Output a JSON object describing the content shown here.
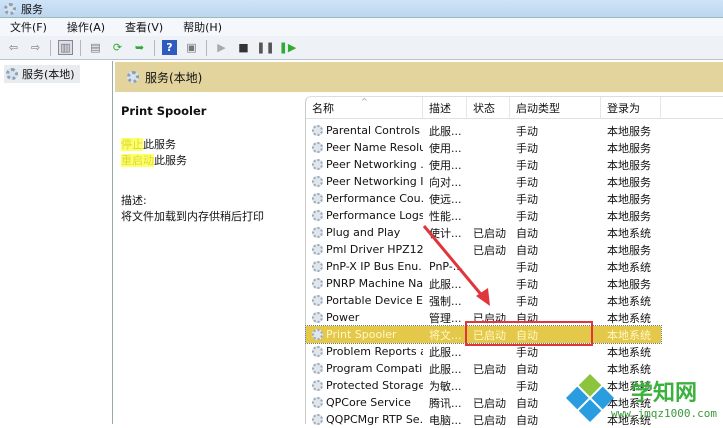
{
  "window": {
    "title": "服务"
  },
  "menu": [
    "文件(F)",
    "操作(A)",
    "查看(V)",
    "帮助(H)"
  ],
  "tree": {
    "root": "服务(本地)"
  },
  "banner": {
    "title": "服务(本地)"
  },
  "details": {
    "service_name": "Print Spooler",
    "stop_link": "停止",
    "stop_suffix": "此服务",
    "restart_link": "重启动",
    "restart_suffix": "此服务",
    "desc_label": "描述:",
    "desc_text": "将文件加载到内存供稍后打印"
  },
  "columns": [
    "名称",
    "描述",
    "状态",
    "启动类型",
    "登录为"
  ],
  "rows": [
    [
      "Parental Controls",
      "此服...",
      "",
      "手动",
      "本地服务"
    ],
    [
      "Peer Name Resolu...",
      "使用...",
      "",
      "手动",
      "本地服务"
    ],
    [
      "Peer Networking ...",
      "使用...",
      "",
      "手动",
      "本地服务"
    ],
    [
      "Peer Networking I...",
      "向对...",
      "",
      "手动",
      "本地服务"
    ],
    [
      "Performance Cou...",
      "使远...",
      "",
      "手动",
      "本地服务"
    ],
    [
      "Performance Logs...",
      "性能...",
      "",
      "手动",
      "本地服务"
    ],
    [
      "Plug and Play",
      "使计...",
      "已启动",
      "自动",
      "本地系统"
    ],
    [
      "Pml Driver HPZ12",
      "",
      "已启动",
      "自动",
      "本地服务"
    ],
    [
      "PnP-X IP Bus Enu...",
      "PnP-...",
      "",
      "手动",
      "本地系统"
    ],
    [
      "PNRP Machine Na...",
      "此服...",
      "",
      "手动",
      "本地服务"
    ],
    [
      "Portable Device E...",
      "强制...",
      "",
      "手动",
      "本地系统"
    ],
    [
      "Power",
      "管理...",
      "已启动",
      "自动",
      "本地系统"
    ],
    [
      "Print Spooler",
      "将文...",
      "已启动",
      "自动",
      "本地系统"
    ],
    [
      "Problem Reports a...",
      "此服...",
      "",
      "手动",
      "本地系统"
    ],
    [
      "Program Compati...",
      "此服...",
      "已启动",
      "自动",
      "本地系统"
    ],
    [
      "Protected Storage",
      "为敏...",
      "",
      "手动",
      "本地系统"
    ],
    [
      "QPCore Service",
      "腾讯...",
      "已启动",
      "自动",
      "本地系统"
    ],
    [
      "QQPCMgr RTP Se...",
      "电脑...",
      "已启动",
      "自动",
      "本地系统"
    ]
  ],
  "selected_index": 12,
  "watermark": {
    "name": "学知网",
    "url": "www.jmqz1000.com"
  }
}
